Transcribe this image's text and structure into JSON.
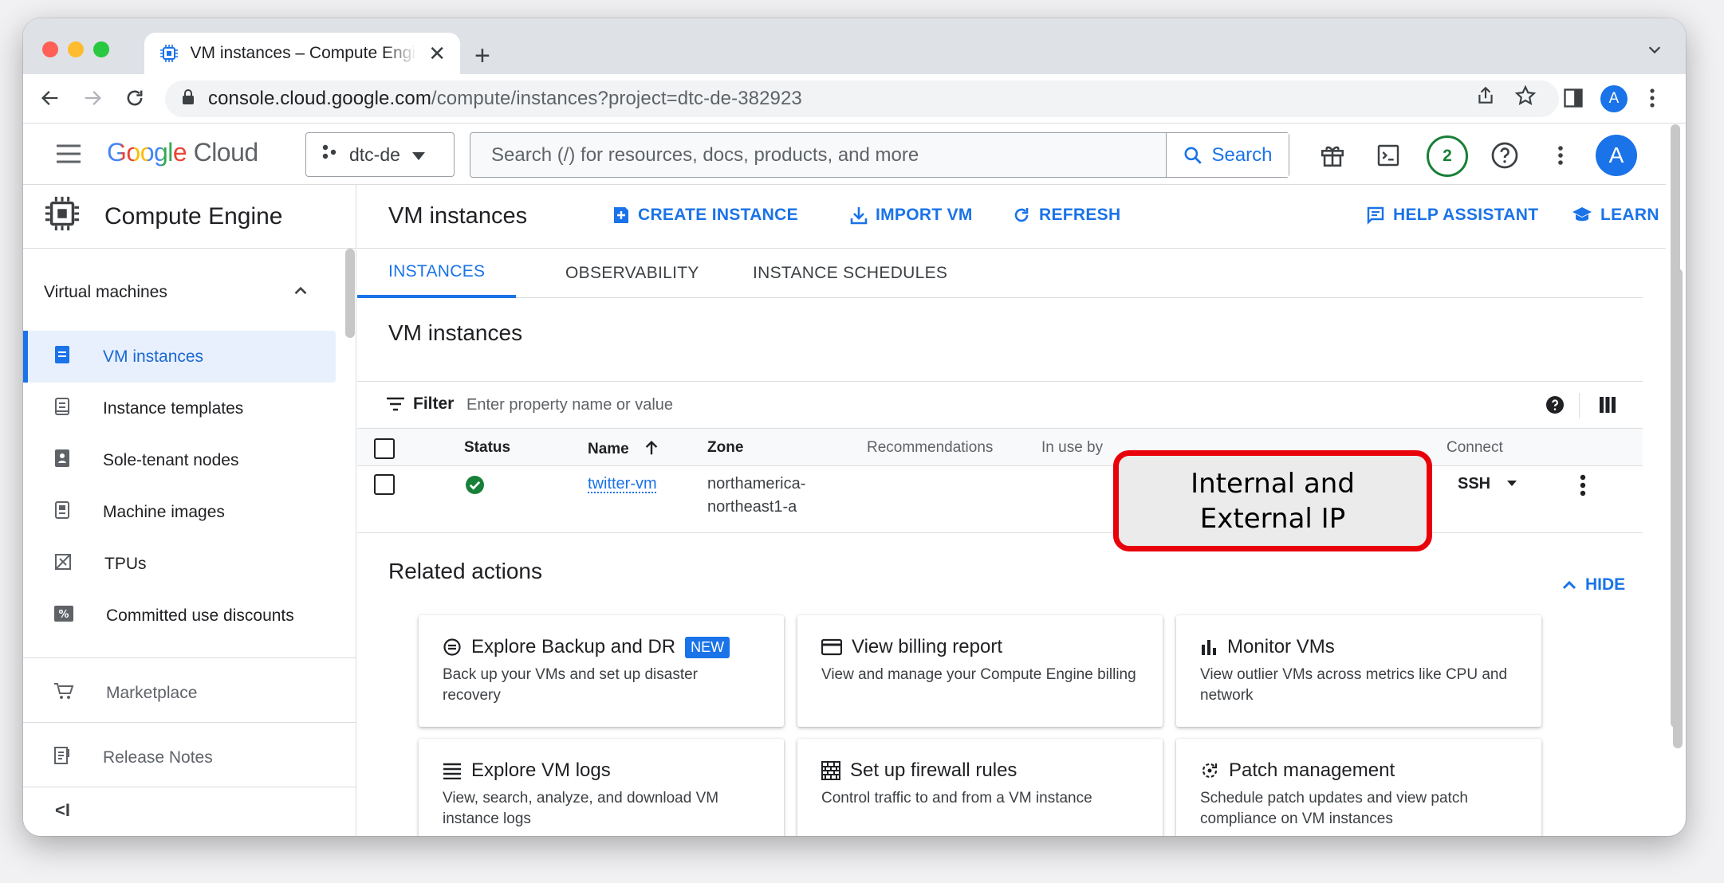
{
  "colors": {
    "accent": "#1a73e8",
    "annotation_border": "#e8000b",
    "status_ok": "#188038"
  },
  "browser": {
    "tab_title": "VM instances – Compute Engine",
    "url_host": "console.cloud.google.com",
    "url_path": "/compute/instances?project=dtc-de-382923",
    "profile_initial": "A"
  },
  "header": {
    "logo_word1": "Google",
    "logo_word2": "Cloud",
    "project": "dtc-de",
    "search_placeholder": "Search (/) for resources, docs, products, and more",
    "search_button": "Search",
    "notifications_count": "2",
    "avatar_initial": "A"
  },
  "sidebar": {
    "product": "Compute Engine",
    "section": "Virtual machines",
    "items": [
      {
        "label": "VM instances",
        "icon": "vm-instance-icon",
        "active": true
      },
      {
        "label": "Instance templates",
        "icon": "template-icon"
      },
      {
        "label": "Sole-tenant nodes",
        "icon": "sole-tenant-icon"
      },
      {
        "label": "Machine images",
        "icon": "machine-image-icon"
      },
      {
        "label": "TPUs",
        "icon": "tpu-icon"
      },
      {
        "label": "Committed use discounts",
        "icon": "percent-icon"
      }
    ],
    "marketplace": "Marketplace",
    "release_notes": "Release Notes",
    "collapse_glyph": "<I"
  },
  "main": {
    "title": "VM instances",
    "actions": {
      "create": "CREATE INSTANCE",
      "import": "IMPORT VM",
      "refresh": "REFRESH",
      "help": "HELP ASSISTANT",
      "learn": "LEARN"
    },
    "tabs": [
      "INSTANCES",
      "OBSERVABILITY",
      "INSTANCE SCHEDULES"
    ],
    "subtitle": "VM instances",
    "filter_label": "Filter",
    "filter_placeholder": "Enter property name or value",
    "columns": [
      "Status",
      "Name",
      "Zone",
      "Recommendations",
      "In use by",
      "Connect"
    ],
    "rows": [
      {
        "status": "running",
        "name": "twitter-vm",
        "zone_line1": "northamerica-",
        "zone_line2": "northeast1-a",
        "connect": "SSH"
      }
    ],
    "related_title": "Related actions",
    "hide_label": "HIDE",
    "cards": [
      {
        "title": "Explore Backup and DR",
        "badge": "NEW",
        "desc": "Back up your VMs and set up disaster recovery",
        "icon": "backup-icon"
      },
      {
        "title": "View billing report",
        "desc": "View and manage your Compute Engine billing",
        "icon": "billing-icon"
      },
      {
        "title": "Monitor VMs",
        "desc": "View outlier VMs across metrics like CPU and network",
        "icon": "monitor-icon"
      },
      {
        "title": "Explore VM logs",
        "desc": "View, search, analyze, and download VM instance logs",
        "icon": "logs-icon"
      },
      {
        "title": "Set up firewall rules",
        "desc": "Control traffic to and from a VM instance",
        "icon": "firewall-icon"
      },
      {
        "title": "Patch management",
        "desc": "Schedule patch updates and view patch compliance on VM instances",
        "icon": "patch-icon"
      }
    ]
  },
  "annotation": {
    "line1": "Internal and",
    "line2": "External IP"
  }
}
